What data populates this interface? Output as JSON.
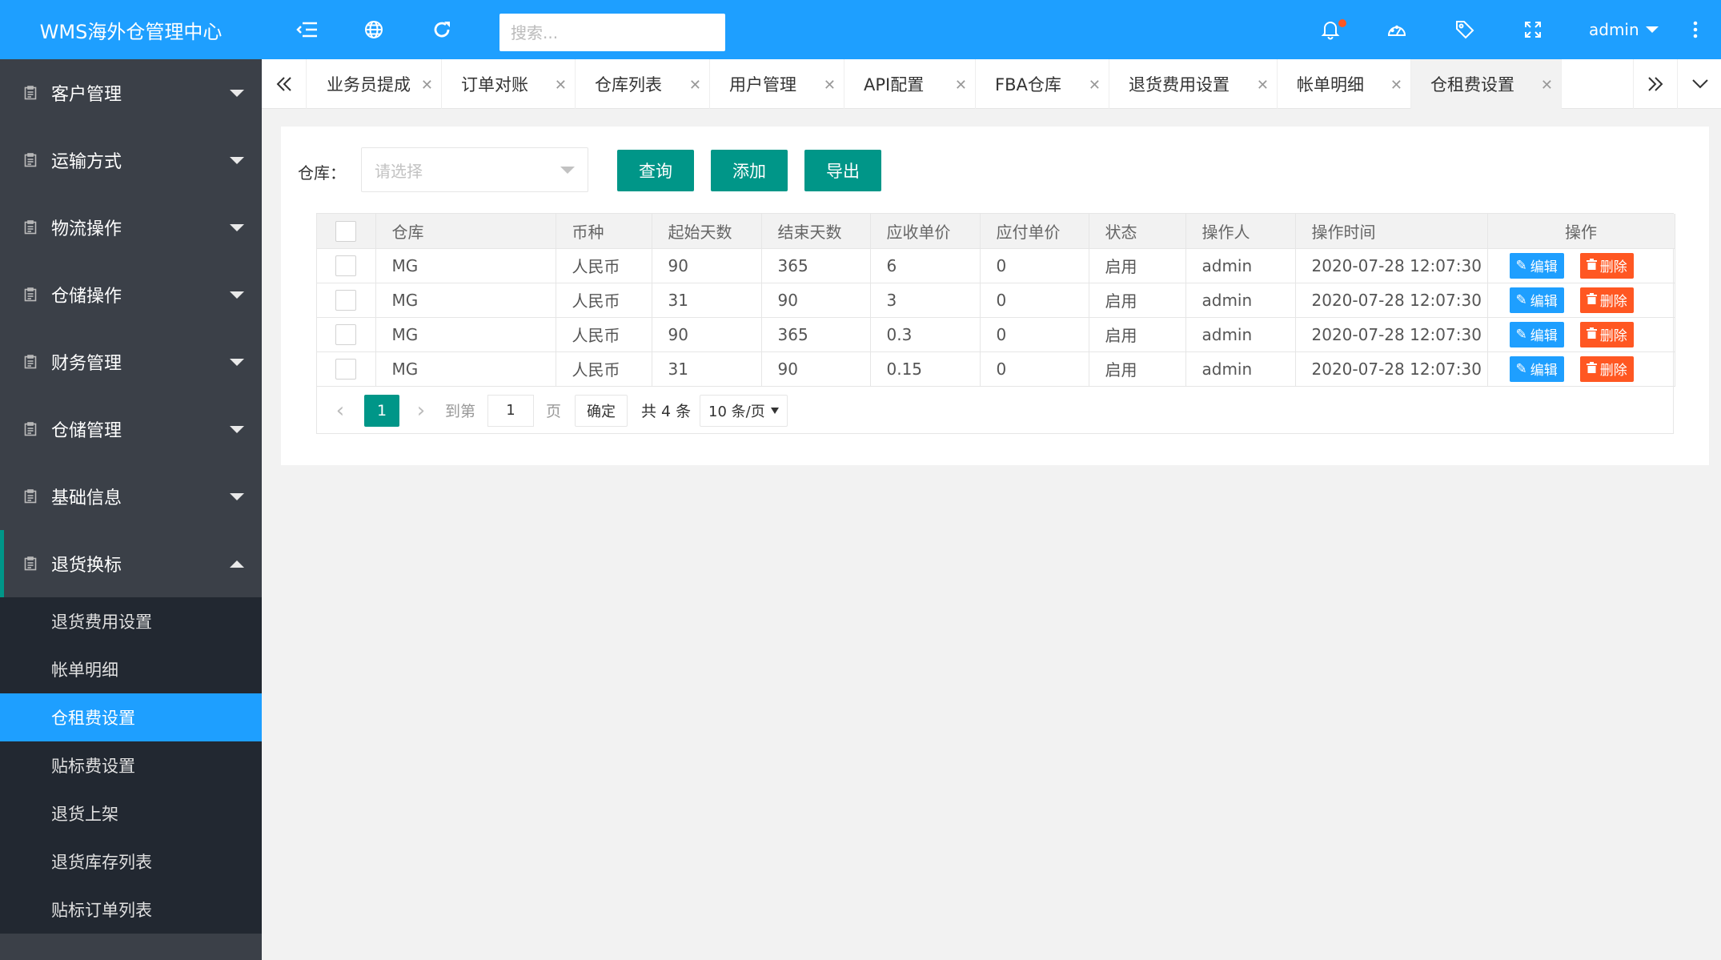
{
  "app": {
    "title": "WMS海外仓管理中心"
  },
  "header": {
    "search_placeholder": "搜索...",
    "user": "admin",
    "icons": [
      "menu-fold-icon",
      "globe-icon",
      "refresh-icon",
      "bell-icon",
      "dashboard-icon",
      "tag-icon",
      "fullscreen-icon",
      "more-icon"
    ]
  },
  "sidebar": {
    "items": [
      {
        "label": "客户管理"
      },
      {
        "label": "运输方式"
      },
      {
        "label": "物流操作"
      },
      {
        "label": "仓储操作"
      },
      {
        "label": "财务管理"
      },
      {
        "label": "仓储管理"
      },
      {
        "label": "基础信息"
      },
      {
        "label": "退货换标",
        "expanded": true
      }
    ],
    "submenu": [
      {
        "label": "退货费用设置"
      },
      {
        "label": "帐单明细"
      },
      {
        "label": "仓租费设置",
        "active": true
      },
      {
        "label": "贴标费设置"
      },
      {
        "label": "退货上架"
      },
      {
        "label": "退货库存列表"
      },
      {
        "label": "贴标订单列表"
      }
    ]
  },
  "tabs": [
    {
      "label": "业务员提成"
    },
    {
      "label": "订单对账"
    },
    {
      "label": "仓库列表"
    },
    {
      "label": "用户管理"
    },
    {
      "label": "API配置"
    },
    {
      "label": "FBA仓库"
    },
    {
      "label": "退货费用设置"
    },
    {
      "label": "帐单明细"
    },
    {
      "label": "仓租费设置",
      "active": true
    }
  ],
  "filter": {
    "warehouse_label": "仓库：",
    "warehouse_placeholder": "请选择",
    "query_btn": "查询",
    "add_btn": "添加",
    "export_btn": "导出"
  },
  "table": {
    "headers": [
      "仓库",
      "币种",
      "起始天数",
      "结束天数",
      "应收单价",
      "应付单价",
      "状态",
      "操作人",
      "操作时间",
      "操作"
    ],
    "rows": [
      [
        "MG",
        "人民币",
        "90",
        "365",
        "6",
        "0",
        "启用",
        "admin",
        "2020-07-28 12:07:30"
      ],
      [
        "MG",
        "人民币",
        "31",
        "90",
        "3",
        "0",
        "启用",
        "admin",
        "2020-07-28 12:07:30"
      ],
      [
        "MG",
        "人民币",
        "90",
        "365",
        "0.3",
        "0",
        "启用",
        "admin",
        "2020-07-28 12:07:30"
      ],
      [
        "MG",
        "人民币",
        "31",
        "90",
        "0.15",
        "0",
        "启用",
        "admin",
        "2020-07-28 12:07:30"
      ]
    ],
    "edit_label": "编辑",
    "delete_label": "删除"
  },
  "pagination": {
    "current_page": "1",
    "goto_label": "到第",
    "goto_value": "1",
    "page_suffix": "页",
    "confirm_label": "确定",
    "total_label": "共 4 条",
    "page_size": "10 条/页"
  },
  "colors": {
    "brand": "#1e9fff",
    "primary_button": "#009688",
    "danger": "#ff5722",
    "sidebar_bg": "#3b4048",
    "submenu_bg": "#222831"
  }
}
